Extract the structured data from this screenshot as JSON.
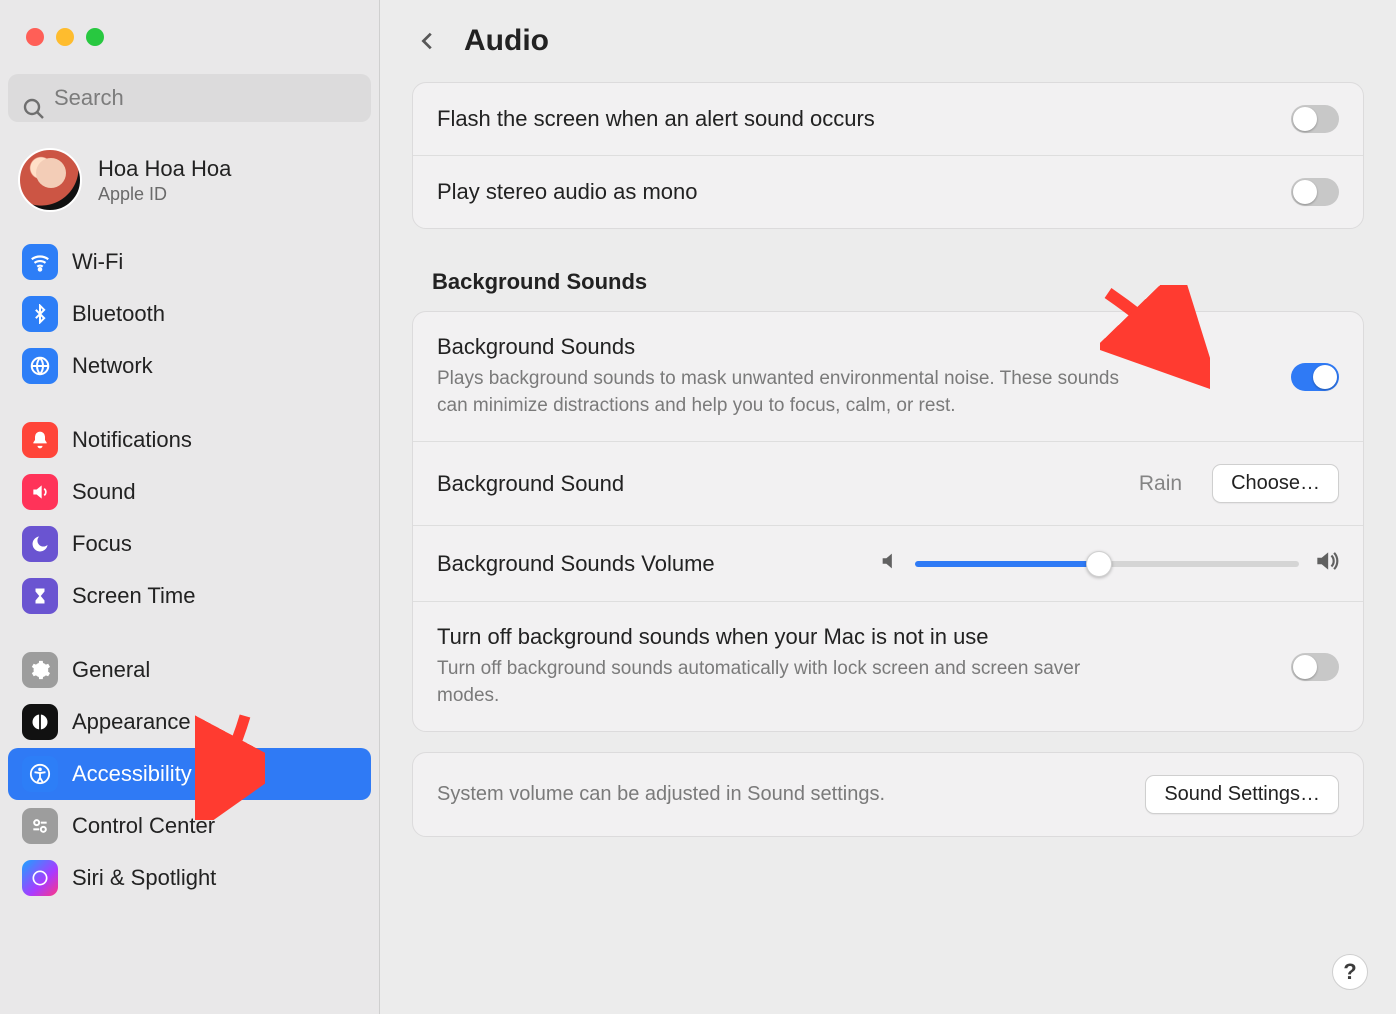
{
  "search": {
    "placeholder": "Search"
  },
  "account": {
    "name": "Hoa Hoa Hoa",
    "sub": "Apple ID"
  },
  "sidebar": {
    "items": [
      {
        "label": "Wi-Fi"
      },
      {
        "label": "Bluetooth"
      },
      {
        "label": "Network"
      },
      {
        "label": "Notifications"
      },
      {
        "label": "Sound"
      },
      {
        "label": "Focus"
      },
      {
        "label": "Screen Time"
      },
      {
        "label": "General"
      },
      {
        "label": "Appearance"
      },
      {
        "label": "Accessibility"
      },
      {
        "label": "Control Center"
      },
      {
        "label": "Siri & Spotlight"
      }
    ]
  },
  "header": {
    "title": "Audio"
  },
  "group1": {
    "flash": {
      "label": "Flash the screen when an alert sound occurs",
      "on": false
    },
    "mono": {
      "label": "Play stereo audio as mono",
      "on": false
    }
  },
  "bg": {
    "section_title": "Background Sounds",
    "enable": {
      "label": "Background Sounds",
      "desc": "Plays background sounds to mask unwanted environmental noise. These sounds can minimize distractions and help you to focus, calm, or rest.",
      "on": true
    },
    "sound": {
      "label": "Background Sound",
      "value": "Rain",
      "choose": "Choose…"
    },
    "volume": {
      "label": "Background Sounds Volume",
      "percent": 48
    },
    "turnoff": {
      "label": "Turn off background sounds when your Mac is not in use",
      "desc": "Turn off background sounds automatically with lock screen and screen saver modes.",
      "on": false
    }
  },
  "footer": {
    "hint": "System volume can be adjusted in Sound settings.",
    "sound_settings": "Sound Settings…"
  },
  "help": "?"
}
